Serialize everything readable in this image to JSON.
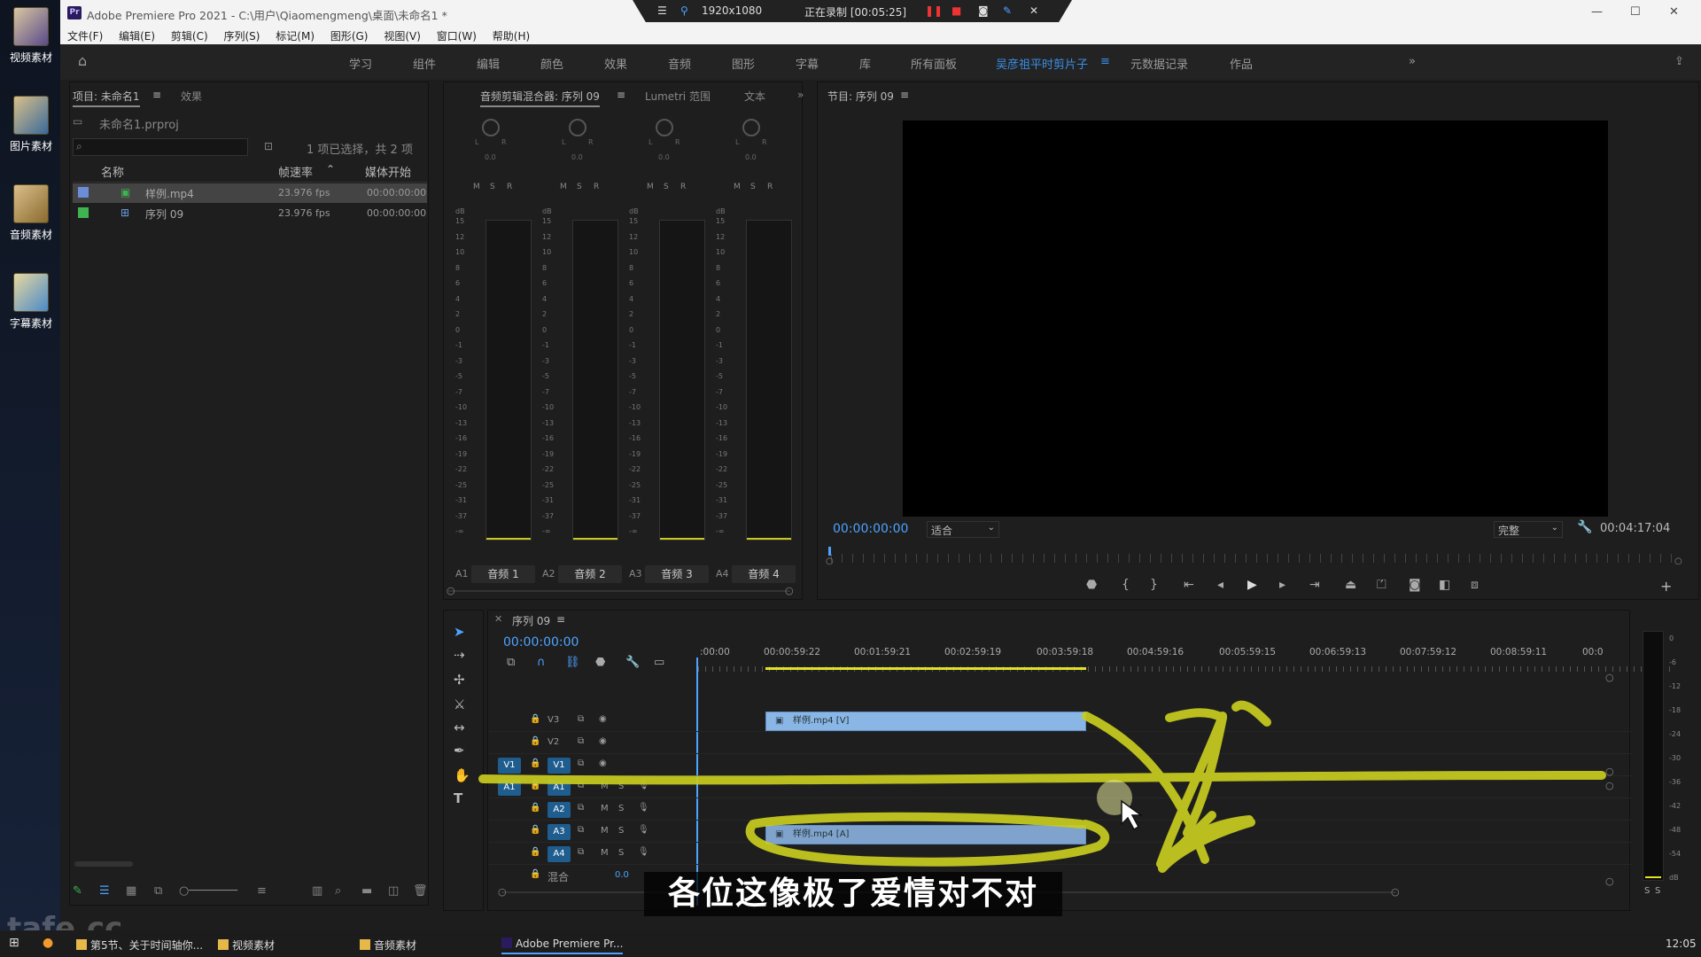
{
  "desktop": {
    "icons": [
      {
        "label": "视频素材"
      },
      {
        "label": "图片素材"
      },
      {
        "label": "音频素材"
      },
      {
        "label": "字幕素材"
      }
    ]
  },
  "window": {
    "app_icon": "Pr",
    "title": "Adobe Premiere Pro 2021 - C:\\用户\\Qiaomengmeng\\桌面\\未命名1 *",
    "recording_resolution": "1920x1080",
    "recording_status": "正在录制 [00:05:25]"
  },
  "menubar": [
    "文件(F)",
    "编辑(E)",
    "剪辑(C)",
    "序列(S)",
    "标记(M)",
    "图形(G)",
    "视图(V)",
    "窗口(W)",
    "帮助(H)"
  ],
  "workspaces": {
    "items": [
      "学习",
      "组件",
      "编辑",
      "颜色",
      "效果",
      "音频",
      "图形",
      "字幕",
      "库",
      "所有面板",
      "吴彦祖平时剪片子",
      "元数据记录",
      "作品"
    ],
    "active": "吴彦祖平时剪片子",
    "overflow": "»"
  },
  "project": {
    "tab": "项目: 未命名1",
    "tab2": "效果",
    "file": "未命名1.prproj",
    "selection": "1 项已选择，共 2 项",
    "columns": [
      "名称",
      "帧速率",
      "媒体开始"
    ],
    "rows": [
      {
        "name": "样例.mp4",
        "fps": "23.976 fps",
        "start": "00:00:00:00",
        "color": "#6b8cd6"
      },
      {
        "name": "序列 09",
        "fps": "23.976 fps",
        "start": "00:00:00:00",
        "color": "#3fb34f"
      }
    ]
  },
  "mixer": {
    "tabs": [
      "音频剪辑混合器: 序列 09",
      "Lumetri 范围",
      "文本"
    ],
    "pan_labels": [
      "L",
      "R"
    ],
    "pan_value": "0.0",
    "msr": [
      "M",
      "S",
      "R"
    ],
    "db_label": "dB",
    "db_scale": [
      "15",
      "12",
      "10",
      "8",
      "6",
      "4",
      "2",
      "0",
      "-1",
      "-3",
      "-5",
      "-7",
      "-10",
      "-13",
      "-16",
      "-19",
      "-22",
      "-25",
      "-31",
      "-37",
      "-∞"
    ],
    "channels": [
      {
        "id": "A1",
        "name": "音频 1"
      },
      {
        "id": "A2",
        "name": "音频 2"
      },
      {
        "id": "A3",
        "name": "音频 3"
      },
      {
        "id": "A4",
        "name": "音频 4"
      }
    ]
  },
  "program": {
    "tab": "节目: 序列 09",
    "timecode": "00:00:00:00",
    "fit": "适合",
    "quality": "完整",
    "duration": "00:04:17:04"
  },
  "timeline": {
    "tab": "序列 09",
    "timecode": "00:00:00:00",
    "ruler": [
      ":00:00",
      "00:00:59:22",
      "00:01:59:21",
      "00:02:59:19",
      "00:03:59:18",
      "00:04:59:16",
      "00:05:59:15",
      "00:06:59:13",
      "00:07:59:12",
      "00:08:59:11",
      "00:0"
    ],
    "video_tracks": [
      "V3",
      "V2",
      "V1"
    ],
    "audio_tracks": [
      "A1",
      "A2",
      "A3",
      "A4"
    ],
    "source_video": "V1",
    "source_audio": "A1",
    "mix_label": "混合",
    "mix_value": "0.0",
    "track_btn_m": "M",
    "track_btn_s": "S",
    "video_clip": "样例.mp4 [V]",
    "audio_clip": "样例.mp4 [A]"
  },
  "audio_meter": {
    "scale": [
      "0",
      "-6",
      "-12",
      "-18",
      "-24",
      "-30",
      "-36",
      "-42",
      "-48",
      "-54",
      "dB"
    ],
    "solo": [
      "S",
      "S"
    ]
  },
  "subtitle": "各位这像极了爱情对不对",
  "taskbar": {
    "items": [
      "第5节、关于时间轴你...",
      "视频素材",
      "音频素材",
      "Adobe Premiere Pr..."
    ],
    "clock": "12:05"
  },
  "watermark": "tafe.cc",
  "colors": {
    "accent": "#3a8ee6",
    "timecode": "#4da3ff",
    "video_clip": "#8ab6e6",
    "track_target": "#1f5d8e",
    "scribble": "#c8cc1e"
  }
}
